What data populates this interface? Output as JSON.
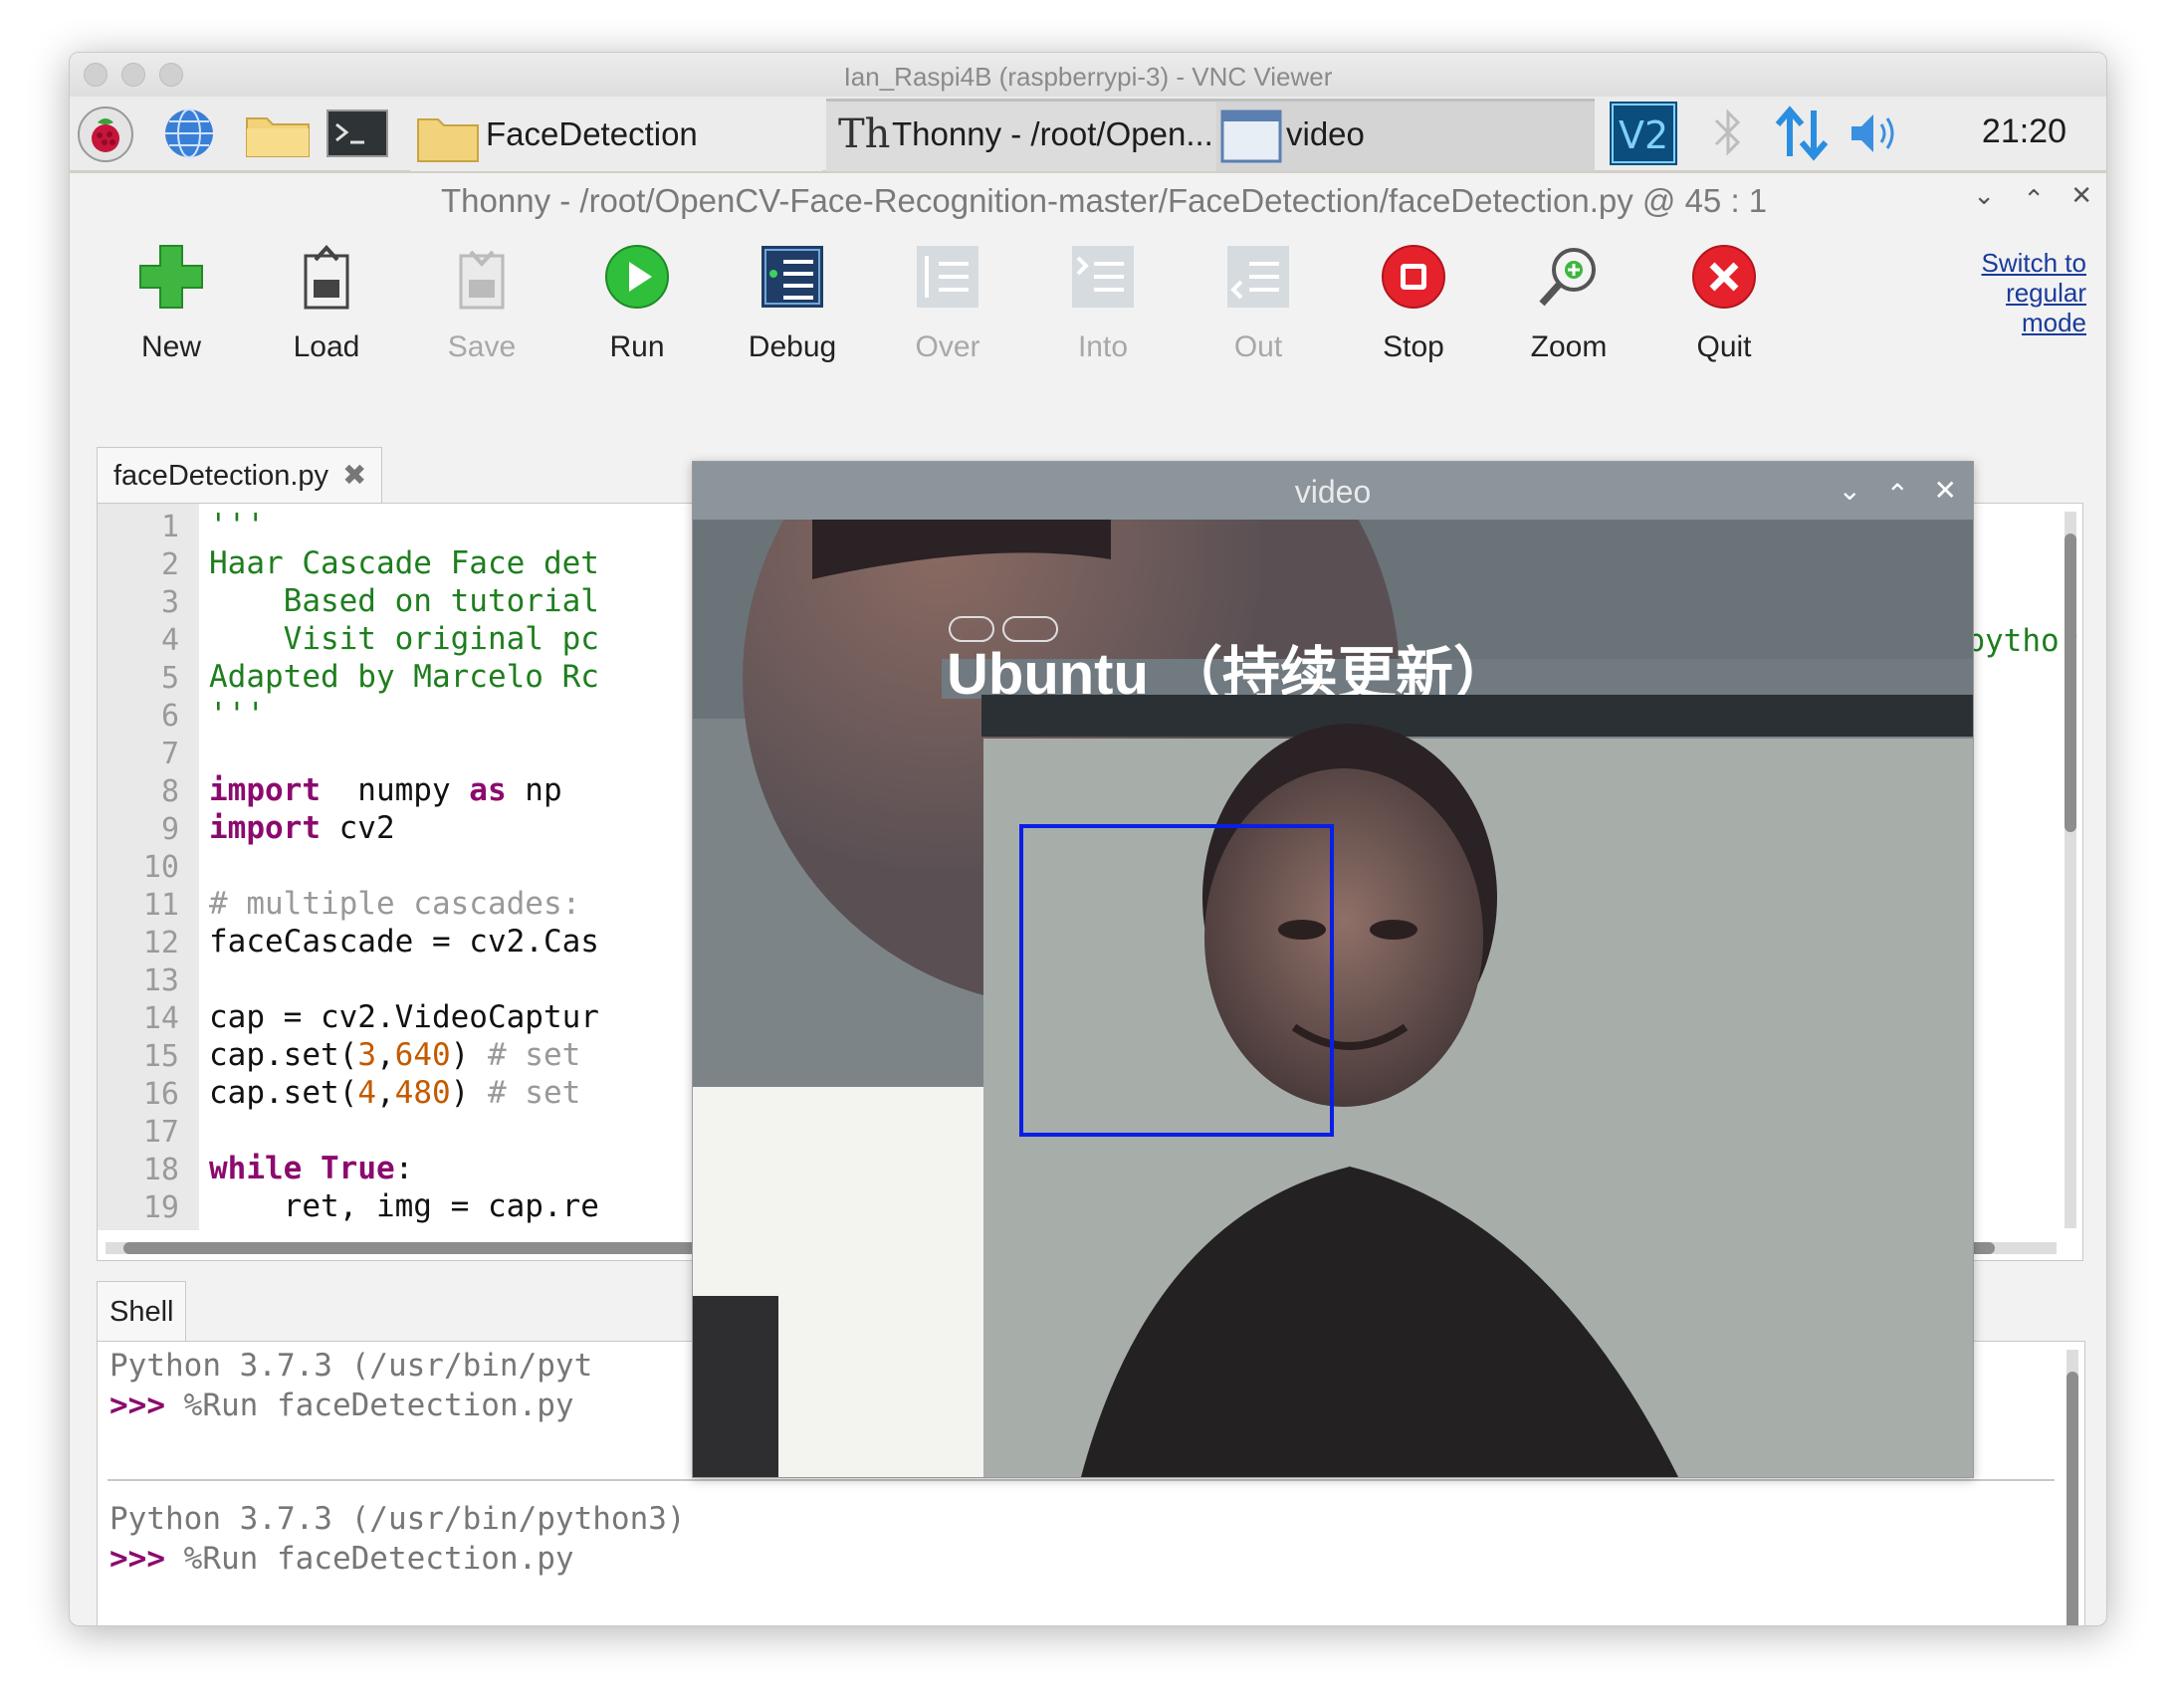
{
  "vnc": {
    "title": "Ian_Raspi4B (raspberrypi-3) - VNC Viewer"
  },
  "taskbar": {
    "folder_task": "FaceDetection",
    "thonny_task": "Thonny  -  /root/Open...",
    "video_task": "video",
    "clock": "21:20",
    "icons": [
      "raspberry-icon",
      "globe-icon",
      "folder-icon",
      "terminal-icon",
      "vnc-icon",
      "bluetooth-icon",
      "network-icon",
      "volume-icon"
    ]
  },
  "thonny": {
    "title": "Thonny  -  /root/OpenCV-Face-Recognition-master/FaceDetection/faceDetection.py  @  45 : 1",
    "toolbar": [
      {
        "label": "New",
        "enabled": true,
        "icon": "new-icon"
      },
      {
        "label": "Load",
        "enabled": true,
        "icon": "load-icon"
      },
      {
        "label": "Save",
        "enabled": false,
        "icon": "save-icon"
      },
      {
        "label": "Run",
        "enabled": true,
        "icon": "run-icon"
      },
      {
        "label": "Debug",
        "enabled": true,
        "icon": "debug-icon"
      },
      {
        "label": "Over",
        "enabled": false,
        "icon": "step-over-icon"
      },
      {
        "label": "Into",
        "enabled": false,
        "icon": "step-into-icon"
      },
      {
        "label": "Out",
        "enabled": false,
        "icon": "step-out-icon"
      },
      {
        "label": "Stop",
        "enabled": true,
        "icon": "stop-icon"
      },
      {
        "label": "Zoom",
        "enabled": true,
        "icon": "zoom-icon"
      },
      {
        "label": "Quit",
        "enabled": true,
        "icon": "quit-icon"
      }
    ],
    "switch_mode": [
      "Switch to",
      "regular",
      "mode"
    ],
    "editor_tab": "faceDetection.py",
    "line_numbers": [
      "1",
      "2",
      "3",
      "4",
      "5",
      "6",
      "7",
      "8",
      "9",
      "10",
      "11",
      "12",
      "13",
      "14",
      "15",
      "16",
      "17",
      "18",
      "19"
    ],
    "code_right_fragment": "n-pythor",
    "shell_tab": "Shell",
    "shell": {
      "line1": "Python 3.7.3 (/usr/bin/pyt",
      "line2_prompt": ">>>",
      "line2_cmd": " %Run faceDetection.py",
      "line3": "Python 3.7.3 (/usr/bin/python3)",
      "line4_prompt": ">>>",
      "line4_cmd": " %Run faceDetection.py"
    }
  },
  "video": {
    "title": "video",
    "detection_box_color": "#0a1ee6"
  }
}
